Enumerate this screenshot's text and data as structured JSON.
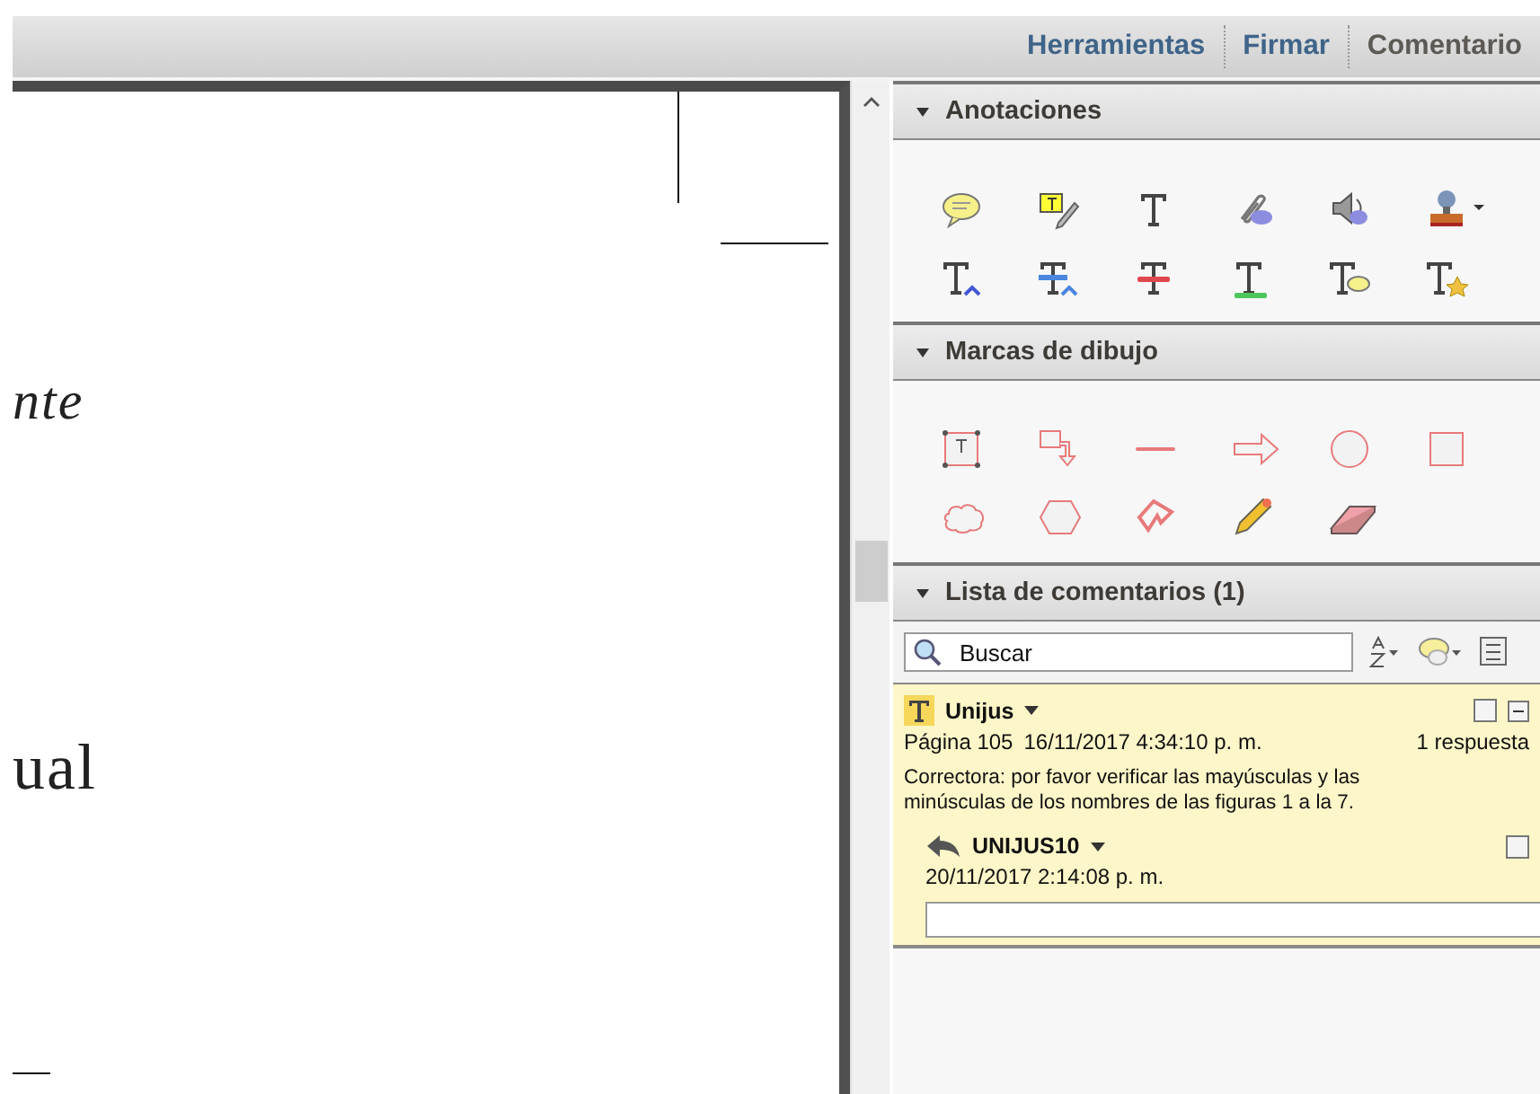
{
  "toolbar": {
    "tabs": [
      {
        "label": "Herramientas",
        "selected": false
      },
      {
        "label": "Firmar",
        "selected": false
      },
      {
        "label": "Comentario",
        "selected": true
      }
    ]
  },
  "document": {
    "lines": [
      {
        "text": "nte",
        "kind": "italic"
      },
      {
        "text": "ual",
        "kind": "regular"
      }
    ]
  },
  "panels": [
    {
      "title": "Anotaciones",
      "expanded": true
    },
    {
      "title": "Marcas de dibujo",
      "expanded": true
    },
    {
      "title": "Lista de comentarios (1)",
      "expanded": true
    }
  ],
  "comments": {
    "search": {
      "placeholder": "Buscar"
    },
    "items": [
      {
        "author": "Unijus",
        "page": "Página 105",
        "date": "16/11/2017 4:34:10 p. m.",
        "replies": "1 respuesta",
        "checked": false,
        "text": "Correctora: por favor verificar las mayúsculas y las minúsculas de los nombres de las figuras 1 a la 7.",
        "reply": {
          "author": "UNIJUS10",
          "date": "20/11/2017 2:14:08 p. m.",
          "checked": false
        }
      }
    ]
  }
}
